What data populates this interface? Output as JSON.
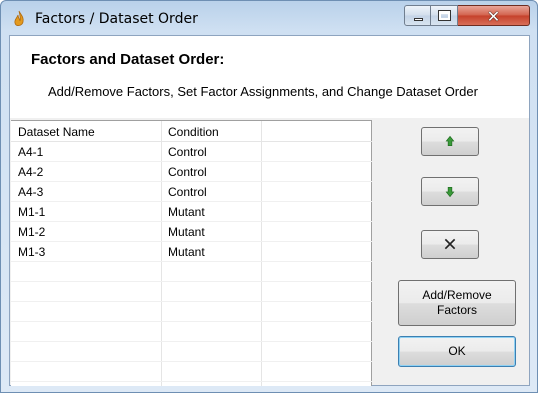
{
  "window": {
    "title": "Factors / Dataset Order"
  },
  "header": {
    "heading": "Factors and Dataset Order:",
    "subheading": "Add/Remove Factors, Set Factor Assignments, and Change Dataset Order"
  },
  "table": {
    "columns": [
      "Dataset Name",
      "Condition"
    ],
    "rows": [
      [
        "A4-1",
        "Control"
      ],
      [
        "A4-2",
        "Control"
      ],
      [
        "A4-3",
        "Control"
      ],
      [
        "M1-1",
        "Mutant"
      ],
      [
        "M1-2",
        "Mutant"
      ],
      [
        "M1-3",
        "Mutant"
      ]
    ]
  },
  "buttons": {
    "move_up_icon": "arrow-up-icon",
    "move_down_icon": "arrow-down-icon",
    "remove_icon": "close-icon",
    "add_remove_factors_line1": "Add/Remove",
    "add_remove_factors_line2": "Factors",
    "ok": "OK"
  },
  "colors": {
    "arrow_green": "#3a9a3a",
    "close_button_red": "#c5402a"
  }
}
